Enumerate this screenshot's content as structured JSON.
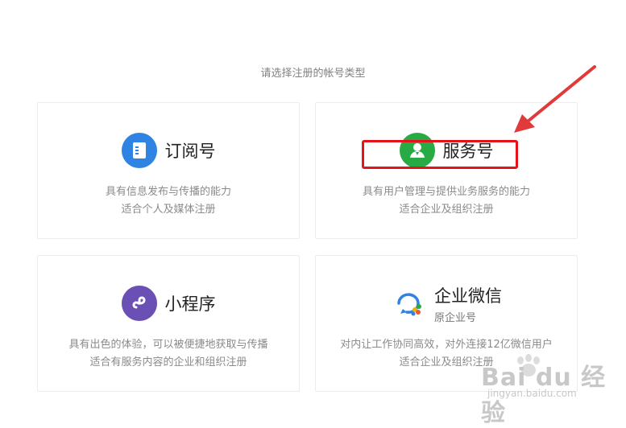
{
  "prompt": "请选择注册的帐号类型",
  "cards": [
    {
      "icon": "document-icon",
      "title": "订阅号",
      "desc_line1": "具有信息发布与传播的能力",
      "desc_line2": "适合个人及媒体注册"
    },
    {
      "icon": "user-badge-icon",
      "title": "服务号",
      "desc_line1": "具有用户管理与提供业务服务的能力",
      "desc_line2": "适合企业及组织注册"
    },
    {
      "icon": "mini-program-icon",
      "title": "小程序",
      "desc_line1": "具有出色的体验，可以被便捷地获取与传播",
      "desc_line2": "适合有服务内容的企业和组织注册"
    },
    {
      "icon": "wecom-icon",
      "title": "企业微信",
      "subtitle": "原企业号",
      "desc_line1": "对内让工作协同高效，对外连接12亿微信用户",
      "desc_line2": "适合企业及组织注册"
    }
  ],
  "annotation": {
    "highlight_color": "#e5121c",
    "arrow_color": "#e03a3a"
  },
  "watermark": {
    "text": "Bai du 经验",
    "url": "jingyan.baidu.com"
  },
  "colors": {
    "subscription": "#2f83e2",
    "service": "#28ab44",
    "mini_program": "#6a4fb4"
  }
}
